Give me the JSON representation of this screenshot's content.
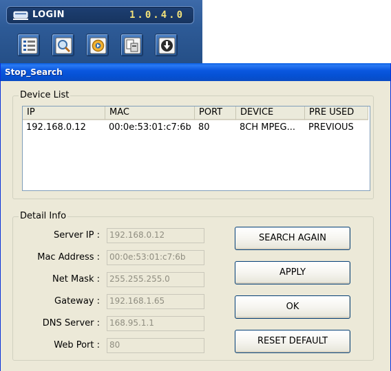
{
  "toolbar": {
    "login_label": "LOGIN",
    "version": "1.0.4.0",
    "icons": [
      "list-view-icon",
      "search-icon",
      "playback-icon",
      "copy-icon",
      "download-icon"
    ]
  },
  "dialog": {
    "title": "Stop_Search",
    "device_list": {
      "legend": "Device List",
      "columns": [
        "IP",
        "MAC",
        "PORT",
        "DEVICE",
        "PRE USED"
      ],
      "rows": [
        {
          "ip": "192.168.0.12",
          "mac": "00:0e:53:01:c7:6b",
          "port": "80",
          "device": "8CH MPEG...",
          "pre_used": "PREVIOUS"
        }
      ]
    },
    "detail": {
      "legend": "Detail Info",
      "fields": [
        {
          "label": "Server IP :",
          "value": "192.168.0.12"
        },
        {
          "label": "Mac Address :",
          "value": "00:0e:53:01:c7:6b"
        },
        {
          "label": "Net Mask :",
          "value": "255.255.255.0"
        },
        {
          "label": "Gateway :",
          "value": "192.168.1.65"
        },
        {
          "label": "DNS Server :",
          "value": "168.95.1.1"
        },
        {
          "label": "Web Port :",
          "value": "80"
        }
      ],
      "buttons": {
        "search_again": "SEARCH AGAIN",
        "apply": "APPLY",
        "ok": "OK",
        "reset_default": "RESET DEFAULT"
      }
    }
  },
  "colors": {
    "toolbar_bg": "#2d5a96",
    "version_text": "#f3e27a",
    "titlebar": "#0b58e0",
    "dialog_bg": "#ece9d8"
  }
}
